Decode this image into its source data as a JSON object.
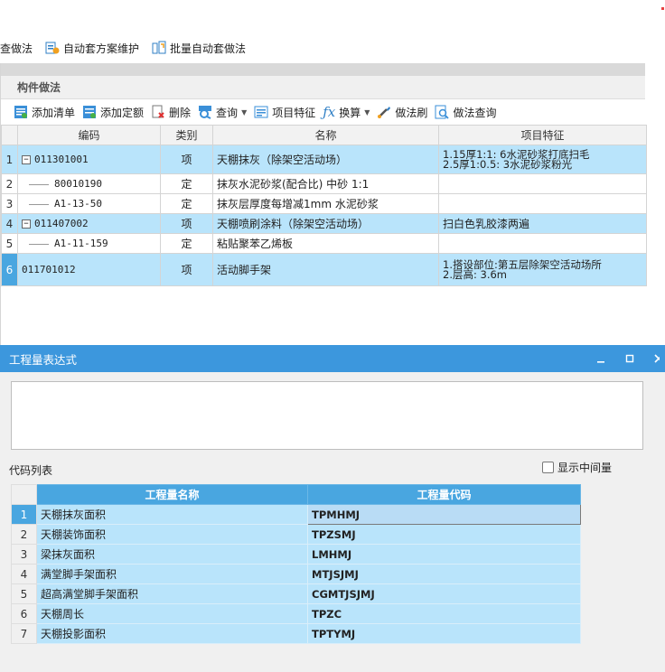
{
  "top_toolbar": {
    "items": [
      {
        "label": "查做法",
        "icon": "none"
      },
      {
        "label": "自动套方案维护",
        "icon": "scheme-icon"
      },
      {
        "label": "批量自动套做法",
        "icon": "batch-icon"
      }
    ]
  },
  "panel": {
    "title": "构件做法",
    "toolbar": [
      {
        "label": "添加清单",
        "icon": "add-list-icon"
      },
      {
        "label": "添加定额",
        "icon": "add-quota-icon"
      },
      {
        "label": "删除",
        "icon": "delete-icon"
      },
      {
        "label": "查询",
        "icon": "query-icon"
      },
      {
        "label": "项目特征",
        "icon": "feature-icon"
      },
      {
        "label": "换算",
        "icon": "fx-icon"
      },
      {
        "label": "做法刷",
        "icon": "brush-icon"
      },
      {
        "label": "做法查询",
        "icon": "method-query-icon"
      }
    ],
    "columns": [
      "编码",
      "类别",
      "名称",
      "项目特征"
    ],
    "rows": [
      {
        "n": "1",
        "code": "011301001",
        "type": "项",
        "name": "天棚抹灰（除架空活动场）",
        "feature": "1.15厚1:1: 6水泥砂浆打底扫毛\n2.5厚1:0.5: 3水泥砂浆粉光"
      },
      {
        "n": "2",
        "code": "80010190",
        "type": "定",
        "name": "抹灰水泥砂浆(配合比) 中砂 1:1",
        "feature": ""
      },
      {
        "n": "3",
        "code": "A1-13-50",
        "type": "定",
        "name": "抹灰层厚度每增减1mm 水泥砂浆",
        "feature": ""
      },
      {
        "n": "4",
        "code": "011407002",
        "type": "项",
        "name": "天棚喷刷涂料（除架空活动场）",
        "feature": "扫白色乳胶漆两遍"
      },
      {
        "n": "5",
        "code": "A1-11-159",
        "type": "定",
        "name": "粘贴聚苯乙烯板",
        "feature": ""
      },
      {
        "n": "6",
        "code": "011701012",
        "type": "项",
        "name": "活动脚手架",
        "feature": "1.搭设部位:第五层除架空活动场所\n2.层高: 3.6m"
      }
    ],
    "tree_toggle": "−"
  },
  "expr_window": {
    "title": "工程量表达式",
    "codes_label": "代码列表",
    "show_intermediate": "显示中间量",
    "columns": [
      "工程量名称",
      "工程量代码"
    ],
    "rows": [
      {
        "n": "1",
        "name": "天棚抹灰面积",
        "code": "TPMHMJ"
      },
      {
        "n": "2",
        "name": "天棚装饰面积",
        "code": "TPZSMJ"
      },
      {
        "n": "3",
        "name": "梁抹灰面积",
        "code": "LMHMJ"
      },
      {
        "n": "4",
        "name": "满堂脚手架面积",
        "code": "MTJSJMJ"
      },
      {
        "n": "5",
        "name": "超高满堂脚手架面积",
        "code": "CGMTJSJMJ"
      },
      {
        "n": "6",
        "name": "天棚周长",
        "code": "TPZC"
      },
      {
        "n": "7",
        "name": "天棚投影面积",
        "code": "TPTYMJ"
      }
    ]
  },
  "colors": {
    "accent": "#3c97dd",
    "row_highlight": "#b9e4fb",
    "header_blue": "#49a6e0"
  }
}
